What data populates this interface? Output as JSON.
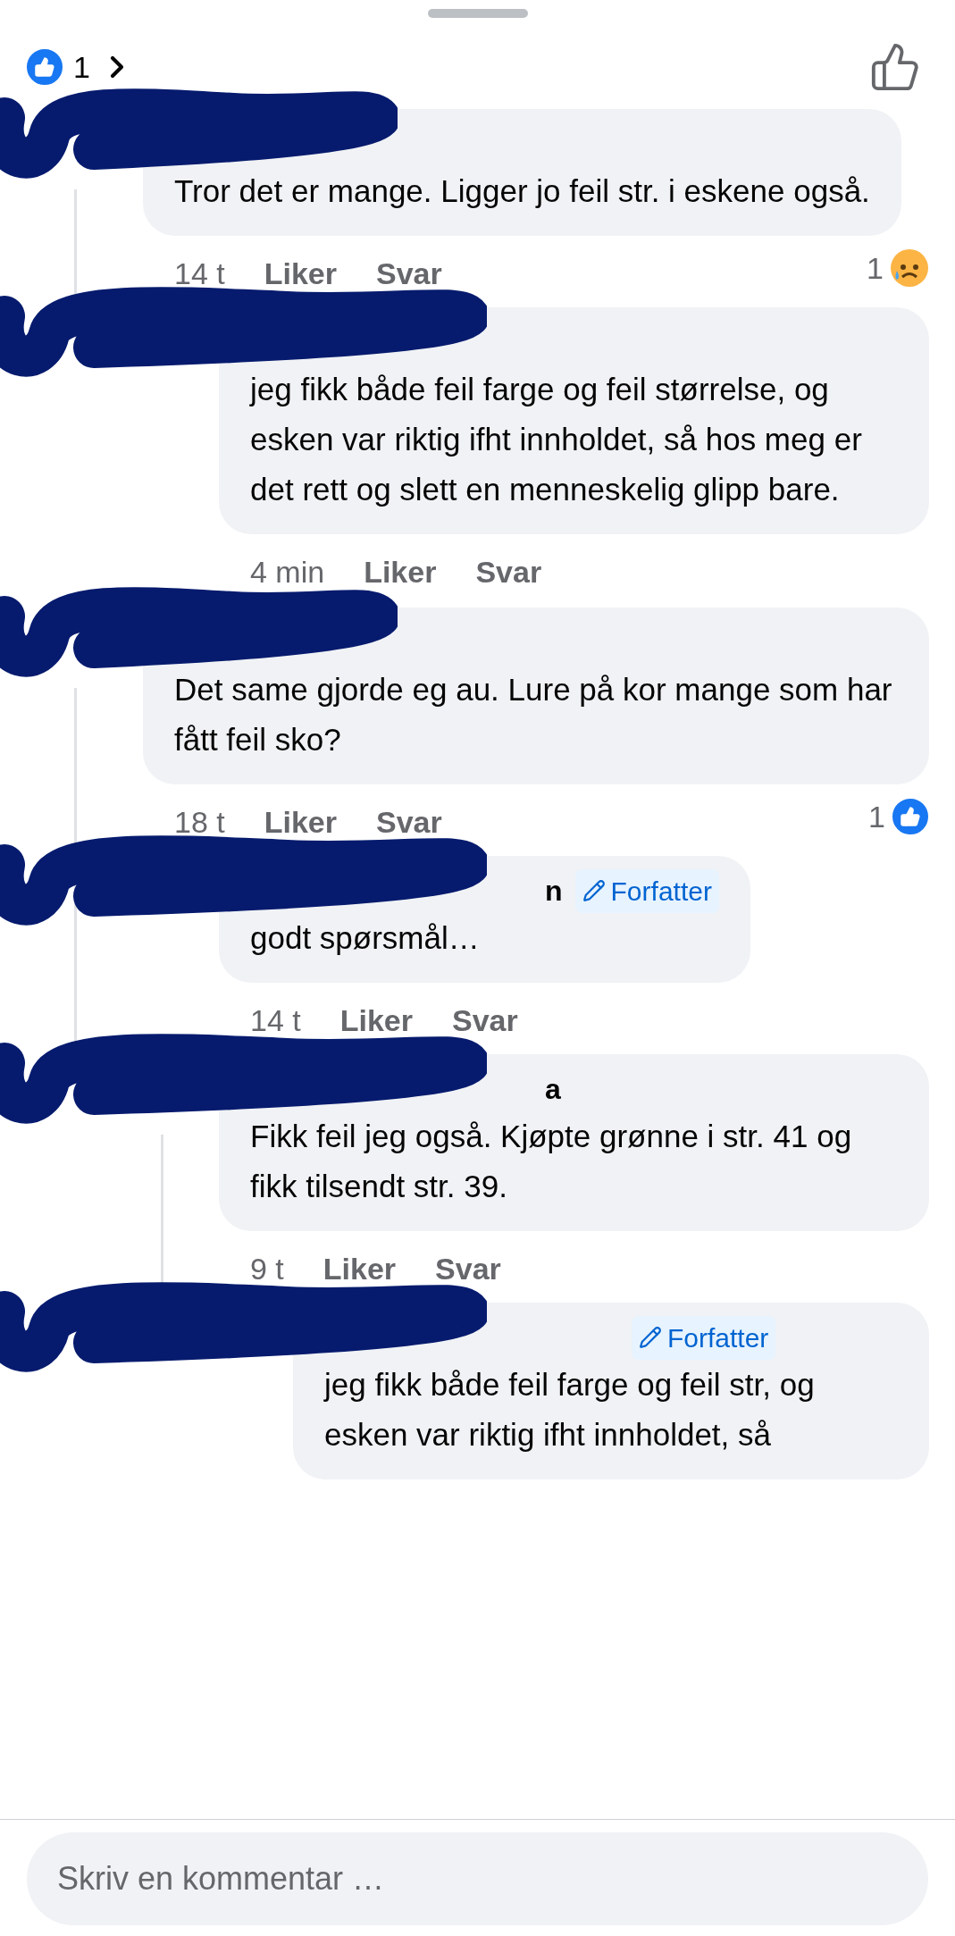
{
  "reactions_summary": {
    "count": "1"
  },
  "comments": [
    {
      "text": "Tror det er mange. Ligger jo feil str. i eskene også.",
      "time": "14 t",
      "actions": [
        "Liker",
        "Svar"
      ],
      "reactions": {
        "count": "1",
        "kind": "sad"
      },
      "replies": [
        {
          "text": "jeg fikk både feil farge og feil størrelse, og esken var riktig ifht innholdet, så hos meg er det rett og slett en menneskelig glipp bare.",
          "time": "4 min",
          "actions": [
            "Liker",
            "Svar"
          ]
        }
      ]
    },
    {
      "text": "Det same gjorde eg au. Lure på kor mange som har fått feil sko?",
      "time": "18 t",
      "actions": [
        "Liker",
        "Svar"
      ],
      "reactions": {
        "count": "1",
        "kind": "like"
      },
      "replies": [
        {
          "author": "n",
          "badge": "Forfatter",
          "text": "godt spørsmål…",
          "time": "14 t",
          "actions": [
            "Liker",
            "Svar"
          ]
        },
        {
          "author": "a",
          "text": "Fikk feil jeg også. Kjøpte grønne i str. 41 og fikk tilsendt str. 39.",
          "time": "9 t",
          "actions": [
            "Liker",
            "Svar"
          ],
          "replies": [
            {
              "badge": "Forfatter",
              "text": "jeg fikk både feil farge og feil str, og esken var riktig ifht innholdet, så"
            }
          ]
        }
      ]
    }
  ],
  "composer": {
    "placeholder": "Skriv en kommentar …"
  }
}
